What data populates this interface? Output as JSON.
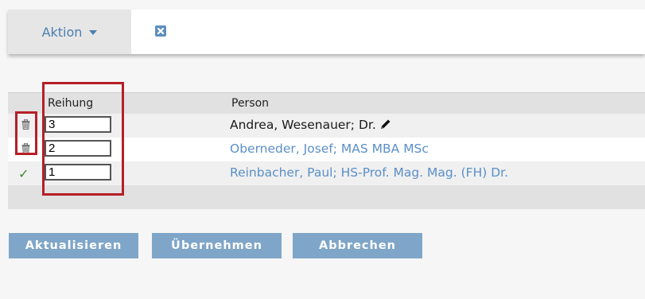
{
  "toolbar": {
    "action_label": "Aktion",
    "close_icon": "close-x-icon"
  },
  "table": {
    "headers": {
      "order": "Reihung",
      "person": "Person"
    },
    "rows": [
      {
        "order": "3",
        "person": "Andrea, Wesenauer; Dr.",
        "status_icon": "trash-icon",
        "is_link": false,
        "edit_icon": "pencil-icon"
      },
      {
        "order": "2",
        "person": "Oberneder, Josef; MAS MBA MSc",
        "status_icon": "trash-icon",
        "is_link": true
      },
      {
        "order": "1",
        "person": "Reinbacher, Paul; HS-Prof. Mag. Mag. (FH) Dr.",
        "status_icon": "check-icon",
        "is_link": true
      }
    ]
  },
  "buttons": {
    "update": "Aktualisieren",
    "apply": "Übernehmen",
    "cancel": "Abbrechen"
  },
  "colors": {
    "accent": "#5b8fc8",
    "button_bg": "#7fa6c8",
    "highlight_box": "#b51f27",
    "check": "#3f8a2e"
  }
}
